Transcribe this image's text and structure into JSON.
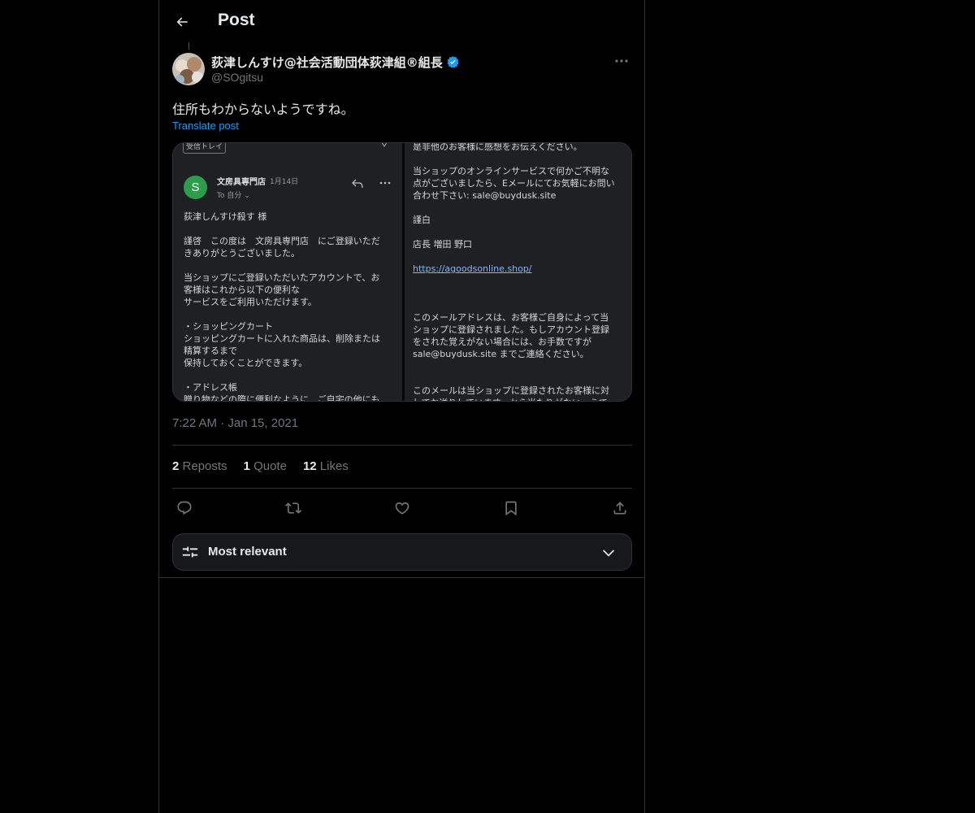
{
  "header": {
    "title": "Post"
  },
  "author": {
    "display_name": "荻津しんすけ@社会活動団体荻津組®組長",
    "handle": "@SOgitsu",
    "verified": true
  },
  "post": {
    "text": "住所もわからないようですね。",
    "translate_label": "Translate post",
    "timestamp": "7:22 AM · Jan 15, 2021"
  },
  "media": {
    "left": {
      "inbox_chip": "受信トレイ",
      "sender_initial": "S",
      "sender_name": "文房具専門店",
      "sender_date": "1月14日",
      "to_line": "To 自分 ⌄",
      "body": "荻津しんすけ殺す 様\n\n謹啓　この度は　文房具専門店　にご登録いただ\nきありがとうございました。\n\n当ショップにご登録いただいたアカウントで、お\n客様はこれから以下の便利な\nサービスをご利用いただけます。\n\n・ショッピングカート\nショッピングカートに入れた商品は、削除または\n精算するまで\n保持しておくことができます。\n\n・アドレス帳\n贈り物などの際に便利なように、ご自宅の他にも"
    },
    "right": {
      "line1": "是非他のお客様に感想をお伝えください。",
      "para1": "当ショップのオンラインサービスで何かご不明な\n点がございましたら、Eメールにてお気軽にお問い\n合わせ下さい: sale@buydusk.site",
      "closing": "謹白",
      "signature": "店長 増田 野口",
      "link": "https://agoodsonline.shop/",
      "para2": "このメールアドレスは、お客様ご自身によって当\nショップに登録されました。もしアカウント登録\nをされた覚えがない場合には、お手数ですが\nsale@buydusk.site までご連絡ください。",
      "para3": "このメールは当ショップに登録されたお客様に対\nしてお送りしています。から当たりがない　うで"
    }
  },
  "stats": {
    "reposts_count": "2",
    "reposts_label": "Reposts",
    "quotes_count": "1",
    "quotes_label": "Quote",
    "likes_count": "12",
    "likes_label": "Likes"
  },
  "actions": [
    "reply-icon",
    "repost-icon",
    "like-icon",
    "bookmark-icon",
    "share-icon"
  ],
  "sort": {
    "label": "Most relevant"
  },
  "colors": {
    "accent": "#1d9bf0",
    "background": "#000000",
    "muted": "#71767b",
    "border": "#2f3336"
  }
}
